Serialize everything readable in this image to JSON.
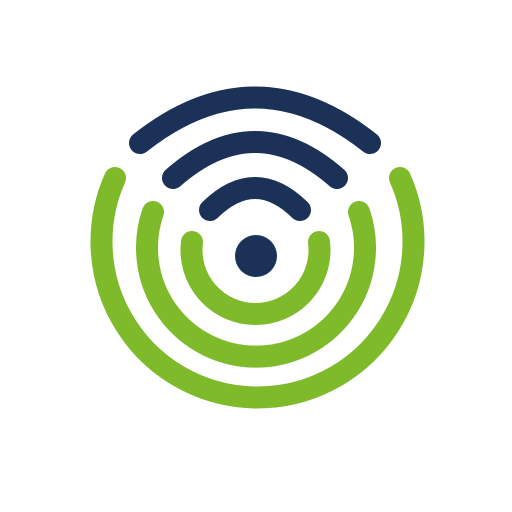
{
  "logo": {
    "icon": "wireless-signal-logo-icon",
    "colors": {
      "background": "#ffffff",
      "navy": "#1b3157",
      "green": "#7fba2a"
    }
  }
}
